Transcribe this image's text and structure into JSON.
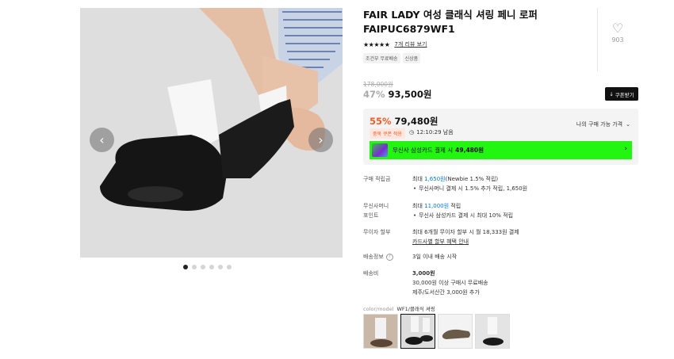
{
  "product": {
    "title": "FAIR LADY 여성 클래식 셔링 페니 로퍼 FAIPUC6879WF1",
    "likes": "903",
    "stars": "★★★★★",
    "review_link": "7개 리뷰 보기",
    "badges": [
      "조건부 무료배송",
      "신상품"
    ]
  },
  "price": {
    "original": "178,000원",
    "sale_pct": "47%",
    "sale_price": "93,500원",
    "coupon_btn": "쿠폰받기"
  },
  "benefit": {
    "best_pct": "55%",
    "best_price": "79,480원",
    "my_price_label": "나의 구매 가능 가격",
    "dup_badge": "중복 쿠폰 적용",
    "timer": "12:10:29 남음",
    "card_text": "무신사 삼성카드 결제 시",
    "card_price": "49,480원"
  },
  "info": {
    "points": {
      "label": "구매 적립금",
      "prefix": "최대",
      "value": "1,650원",
      "suffix": "(Newbie 1.5% 적립)",
      "bullet": "무신사머니 결제 시 1.5% 추가 적립, 1,650원"
    },
    "money": {
      "label1": "무신사머니",
      "label2": "포인트",
      "prefix": "최대",
      "value": "11,000원",
      "suffix": "적립",
      "bullet": "무신사 삼성카드 결제 시 최대 10% 적립"
    },
    "installment": {
      "label": "무이자 할부",
      "line1": "최대 6개월 무이자 할부 시 월 18,333원 결제",
      "link": "카드사별 할부 혜택 안내"
    },
    "delivery": {
      "label": "배송정보",
      "help": "?",
      "value": "3일 이내 배송 시작"
    },
    "shipping": {
      "label": "배송비",
      "value": "3,000원",
      "line2": "30,000원 이상 구매시 무료배송",
      "line3": "제주/도서산간 3,000원 추가"
    }
  },
  "color": {
    "label": "color/model",
    "value": "WF1/클래식 셔링"
  },
  "gallery": {
    "prev": "‹",
    "next": "›",
    "dot_count": 6,
    "active_dot": 1
  }
}
